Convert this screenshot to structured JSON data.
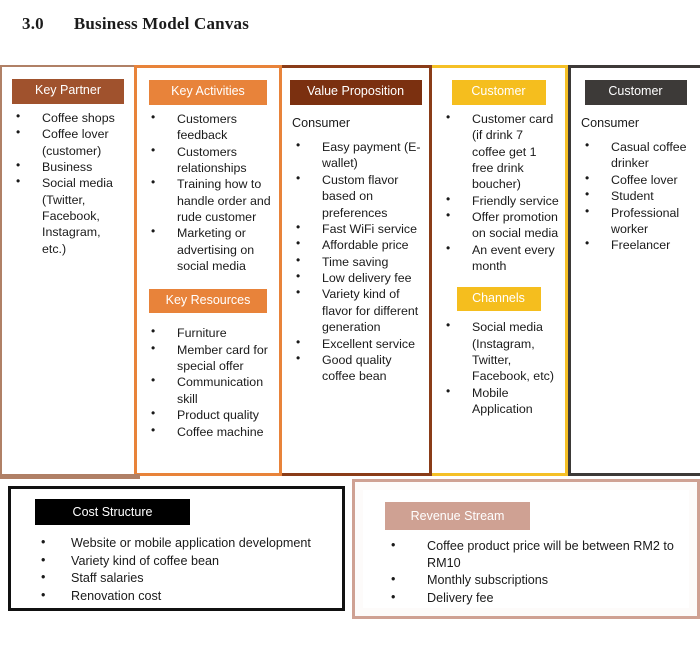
{
  "title": {
    "number": "3.0",
    "text": "Business Model Canvas"
  },
  "colors": {
    "key_partner": "#a0522d",
    "key_activities": "#e8833a",
    "key_resources": "#e8833a",
    "value_proposition": "#7b3010",
    "customer_relationships": "#f5be1e",
    "channels": "#f5be1e",
    "customer_segments": "#3d3a38",
    "cost_structure": "#000000",
    "revenue_stream": "#cfa193"
  },
  "blocks": {
    "key_partner": {
      "label": "Key Partner",
      "items": [
        "Coffee shops",
        "Coffee lover (customer)",
        "Business",
        "Social media (Twitter, Facebook, Instagram, etc.)"
      ]
    },
    "key_activities": {
      "label": "Key Activities",
      "items": [
        "Customers feedback",
        "Customers relationships",
        "Training how to handle order and rude customer",
        "Marketing or advertising on social media"
      ]
    },
    "key_resources": {
      "label": "Key Resources",
      "items": [
        "Furniture",
        "Member card for special offer",
        "Communication skill",
        "Product quality",
        "Coffee machine"
      ]
    },
    "value_proposition": {
      "label": "Value Proposition",
      "intro": "Consumer",
      "items": [
        "Easy payment (E-wallet)",
        "Custom flavor based on preferences",
        "Fast WiFi service",
        "Affordable price",
        "Time saving",
        "Low delivery fee",
        "Variety kind of flavor for different generation",
        "Excellent service",
        "Good quality coffee bean"
      ]
    },
    "customer_relationships": {
      "label": "Customer",
      "items": [
        "Customer card (if drink 7 coffee get 1 free drink boucher)",
        "Friendly service",
        "Offer promotion on social media",
        "An event every month"
      ]
    },
    "channels": {
      "label": "Channels",
      "items": [
        "Social media (Instagram, Twitter, Facebook, etc)",
        "Mobile Application"
      ]
    },
    "customer_segments": {
      "label": "Customer",
      "intro": "Consumer",
      "items": [
        "Casual coffee drinker",
        "Coffee lover",
        "Student",
        "Professional worker",
        "Freelancer"
      ]
    },
    "cost_structure": {
      "label": "Cost Structure",
      "items": [
        "Website or mobile application development",
        "Variety kind of coffee bean",
        "Staff salaries",
        "Renovation cost"
      ]
    },
    "revenue_stream": {
      "label": "Revenue Stream",
      "items": [
        "Coffee product price will be between RM2 to RM10",
        "Monthly subscriptions",
        "Delivery fee"
      ]
    }
  }
}
